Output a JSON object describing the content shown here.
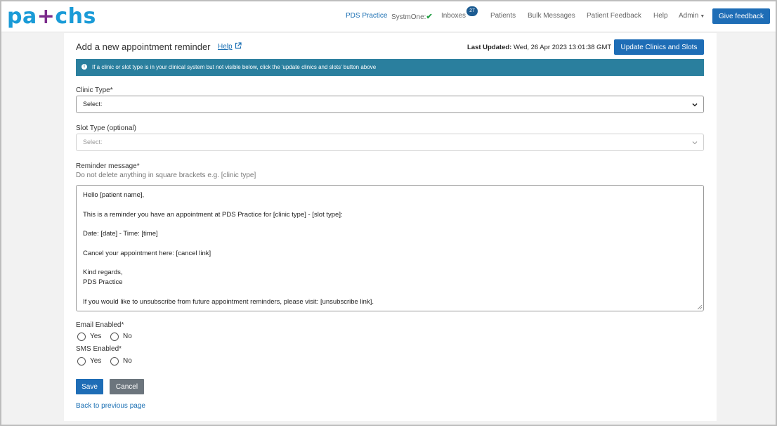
{
  "brand": {
    "logo_left": "pa",
    "logo_plus": "+",
    "logo_right": "chs"
  },
  "nav": {
    "practice": "PDS Practice",
    "system": "SystmOne:",
    "inboxes": "Inboxes",
    "inbox_count": "27",
    "patients": "Patients",
    "bulk_messages": "Bulk Messages",
    "patient_feedback": "Patient Feedback",
    "help": "Help",
    "admin": "Admin",
    "give_feedback": "Give feedback"
  },
  "header": {
    "title": "Add a new appointment reminder",
    "help_link": "Help",
    "last_updated_label": "Last Updated:",
    "last_updated_value": "Wed, 26 Apr 2023 13:01:38 GMT",
    "update_button": "Update Clinics and Slots"
  },
  "info_message": "If a clinic or slot type is in your clinical system but not visible below, click the 'update clinics and slots' button above",
  "form": {
    "clinic_type_label": "Clinic Type*",
    "clinic_type_value": "Select:",
    "slot_type_label": "Slot Type (optional)",
    "slot_type_placeholder": "Select:",
    "reminder_label": "Reminder message*",
    "reminder_hint": "Do not delete anything in square brackets e.g. [clinic type]",
    "reminder_lines": [
      "Hello [patient name],",
      "",
      "This is a reminder you have an appointment at PDS Practice for [clinic type] - [slot type]:",
      "",
      "Date: [date] - Time: [time]",
      "",
      "Cancel your appointment here: [cancel link]",
      "",
      "Kind regards,",
      "PDS Practice",
      "",
      "If you would like to unsubscribe from future appointment reminders, please visit: [unsubscribe link]."
    ],
    "email_label": "Email Enabled*",
    "sms_label": "SMS Enabled*",
    "yes": "Yes",
    "no": "No",
    "save": "Save",
    "cancel": "Cancel",
    "back_link": "Back to previous page"
  }
}
